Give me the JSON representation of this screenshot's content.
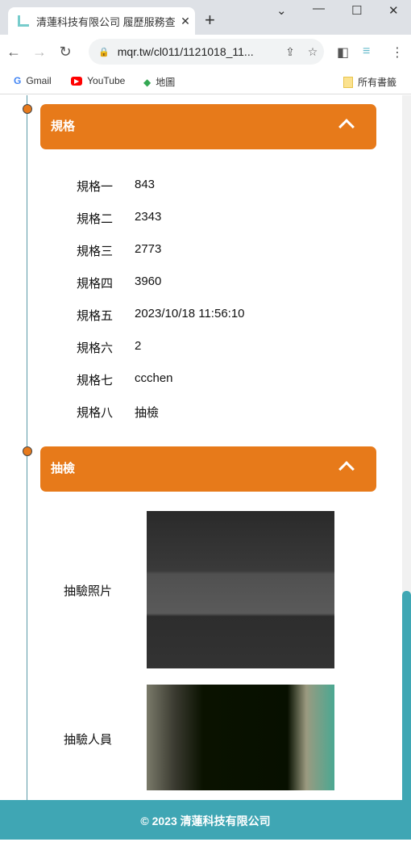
{
  "browser": {
    "tab_title": "清蓮科技有限公司 履歷服務查詢",
    "url": "mqr.tw/cl011/1121018_11...",
    "bookmarks": [
      "Gmail",
      "YouTube",
      "地圖"
    ],
    "all_bookmarks": "所有書籤"
  },
  "spec": {
    "title": "規格",
    "rows": [
      {
        "label": "規格一",
        "value": "843"
      },
      {
        "label": "規格二",
        "value": "2343"
      },
      {
        "label": "規格三",
        "value": "2773"
      },
      {
        "label": "規格四",
        "value": "3960"
      },
      {
        "label": "規格五",
        "value": "2023/10/18 11:56:10"
      },
      {
        "label": "規格六",
        "value": "2"
      },
      {
        "label": "規格七",
        "value": "ccchen"
      },
      {
        "label": "規格八",
        "value": "抽檢"
      }
    ]
  },
  "inspection": {
    "title": "抽檢",
    "photo_label": "抽驗照片",
    "inspector_label": "抽驗人員"
  },
  "footer": {
    "text": "© 2023 清蓮科技有限公司"
  },
  "colors": {
    "accent": "#e77a1a",
    "footer": "#3fa6b4"
  }
}
